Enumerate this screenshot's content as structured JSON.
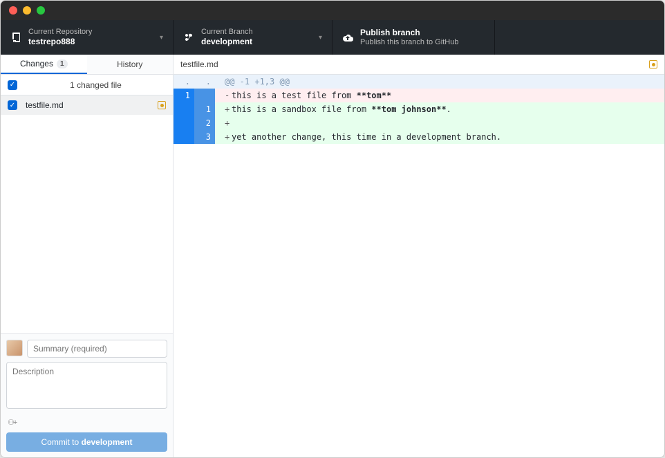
{
  "toolbar": {
    "repo": {
      "label": "Current Repository",
      "value": "testrepo888"
    },
    "branch": {
      "label": "Current Branch",
      "value": "development"
    },
    "publish": {
      "label": "Publish branch",
      "value": "Publish this branch to GitHub"
    }
  },
  "tabs": {
    "changes": "Changes",
    "changes_count": "1",
    "history": "History"
  },
  "changes": {
    "header": "1 changed file",
    "file": "testfile.md"
  },
  "diff": {
    "filename": "testfile.md",
    "hunk": "@@ -1 +1,3 @@",
    "lines": [
      {
        "type": "del",
        "oldNo": "1",
        "newNo": "",
        "sign": "-",
        "pre": "this is a test file from ",
        "bold": "**tom**",
        "post": ""
      },
      {
        "type": "add",
        "oldNo": "",
        "newNo": "1",
        "sign": "+",
        "pre": "this is a sandbox file from ",
        "bold": "**tom johnson**",
        "post": "."
      },
      {
        "type": "add",
        "oldNo": "",
        "newNo": "2",
        "sign": "+",
        "pre": "",
        "bold": "",
        "post": ""
      },
      {
        "type": "add",
        "oldNo": "",
        "newNo": "3",
        "sign": "+",
        "pre": "yet another change, this time in a development branch.",
        "bold": "",
        "post": ""
      }
    ]
  },
  "commit": {
    "summary_placeholder": "Summary (required)",
    "description_placeholder": "Description",
    "coauthor_glyph": "👤+",
    "button_prefix": "Commit to ",
    "button_branch": "development"
  }
}
